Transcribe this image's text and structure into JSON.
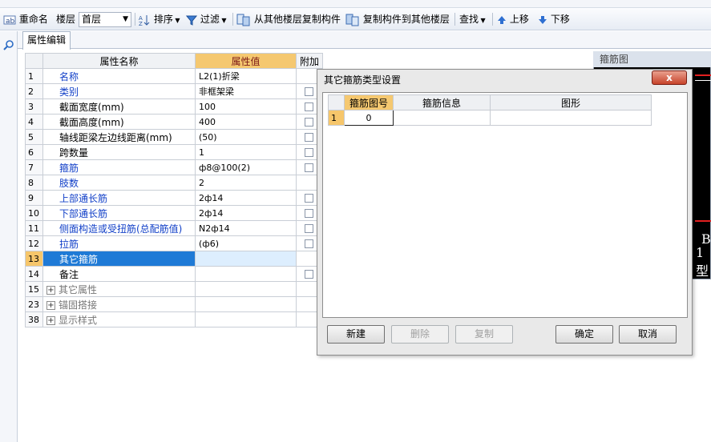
{
  "toolbar": {
    "rename": "重命名",
    "floor_label": "楼层",
    "floor_value": "首层",
    "sort": "排序",
    "filter": "过滤",
    "copy_from": "从其他楼层复制构件",
    "copy_to": "复制构件到其他楼层",
    "find": "查找",
    "move_up": "上移",
    "move_down": "下移"
  },
  "tab": {
    "label": "属性编辑"
  },
  "grid": {
    "headers": {
      "name": "属性名称",
      "value": "属性值",
      "extra": "附加"
    },
    "rows": [
      {
        "num": "1",
        "name": "名称",
        "value": "L2(1)折梁",
        "style": "blue",
        "check": false
      },
      {
        "num": "2",
        "name": "类别",
        "value": "非框架梁",
        "style": "blue",
        "check": true
      },
      {
        "num": "3",
        "name": "截面宽度(mm)",
        "value": "100",
        "style": "black",
        "check": true
      },
      {
        "num": "4",
        "name": "截面高度(mm)",
        "value": "400",
        "style": "black",
        "check": true
      },
      {
        "num": "5",
        "name": "轴线距梁左边线距离(mm)",
        "value": "(50)",
        "style": "black",
        "check": true
      },
      {
        "num": "6",
        "name": "跨数量",
        "value": "1",
        "style": "black",
        "check": true
      },
      {
        "num": "7",
        "name": "箍筋",
        "value": "ф8@100(2)",
        "style": "blue",
        "check": true
      },
      {
        "num": "8",
        "name": "肢数",
        "value": "2",
        "style": "blue",
        "check": false
      },
      {
        "num": "9",
        "name": "上部通长筋",
        "value": "2ф14",
        "style": "blue",
        "check": true
      },
      {
        "num": "10",
        "name": "下部通长筋",
        "value": "2ф14",
        "style": "blue",
        "check": true
      },
      {
        "num": "11",
        "name": "侧面构造或受扭筋(总配筋值)",
        "value": "N2ф14",
        "style": "blue",
        "check": true
      },
      {
        "num": "12",
        "name": "拉筋",
        "value": "(ф6)",
        "style": "blue",
        "check": true
      },
      {
        "num": "13",
        "name": "其它箍筋",
        "value": "",
        "style": "selected",
        "check": false
      },
      {
        "num": "14",
        "name": "备注",
        "value": "",
        "style": "black",
        "check": true
      },
      {
        "num": "15",
        "name": "其它属性",
        "value": "",
        "style": "group",
        "check": false
      },
      {
        "num": "23",
        "name": "锚固搭接",
        "value": "",
        "style": "group",
        "check": false
      },
      {
        "num": "38",
        "name": "显示样式",
        "value": "",
        "style": "group",
        "check": false
      }
    ]
  },
  "preview": {
    "title": "箍筋图",
    "glyph_b": "B",
    "glyph_1": "1型"
  },
  "dialog": {
    "title": "其它箍筋类型设置",
    "close": "x",
    "columns": [
      "箍筋图号",
      "箍筋信息",
      "图形"
    ],
    "rows": [
      {
        "num": "1",
        "shape_no": "0",
        "info": "",
        "figure": ""
      }
    ],
    "buttons": {
      "new": "新建",
      "delete": "删除",
      "copy": "复制",
      "ok": "确定",
      "cancel": "取消"
    }
  },
  "colors": {
    "accent": "#f5c870",
    "selection": "#1f7ad6",
    "close_red": "#c7432a"
  }
}
